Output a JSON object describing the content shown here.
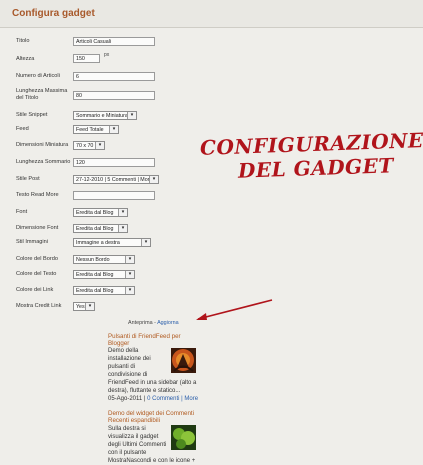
{
  "header": {
    "title": "Configura gadget"
  },
  "form": {
    "titolo": {
      "label": "Titolo",
      "value": "Articoli Casuali"
    },
    "altezza": {
      "label": "Altezza",
      "value": "150",
      "unit": "px"
    },
    "numero": {
      "label": "Numero di Articoli",
      "value": "6"
    },
    "lunghezza_titolo": {
      "label": "Lunghezza Massima del Titolo",
      "value": "80"
    },
    "stile_snippet": {
      "label": "Stile Snippet",
      "value": "Sommario e Miniatura"
    },
    "feed": {
      "label": "Feed",
      "value": "Feed Totale"
    },
    "dimensioni_miniatura": {
      "label": "Dimensioni Miniatura",
      "value": "70 x 70"
    },
    "lunghezza_sommario": {
      "label": "Lunghezza Sommario",
      "value": "120"
    },
    "stile_post": {
      "label": "Stile Post",
      "value": "27-12-2010 | 5 Commenti | More »"
    },
    "testo_read_more": {
      "label": "Testo Read More",
      "value": ""
    },
    "font": {
      "label": "Font",
      "value": "Eredita dal Blog"
    },
    "dimensione_font": {
      "label": "Dimensione Font",
      "value": "Eredita dal Blog"
    },
    "stil_immagini": {
      "label": "Stil Immagini",
      "value": "Immagine a destra"
    },
    "colore_bordo": {
      "label": "Colore del Bordo",
      "value": "Nessun Bordo"
    },
    "colore_testo": {
      "label": "Colore del Testo",
      "value": "Eredita dal Blog"
    },
    "colore_link": {
      "label": "Colore dei Link",
      "value": "Eredita dal Blog"
    },
    "mostra_credit": {
      "label": "Mostra Credit Link",
      "value": "Yes"
    }
  },
  "annotation": {
    "line1": "CONFIGURAZIONE",
    "line2": "DEL GADGET"
  },
  "preview": {
    "label": "Anteprima",
    "separator": " - ",
    "refresh": "Aggiorna",
    "posts": [
      {
        "title": "Pulsanti di FriendFeed per Blogger",
        "body": [
          "Demo della",
          "installazione dei",
          "pulsanti di",
          "condivisione di"
        ],
        "body_full": [
          "FriendFeed in una sidebar (alto a",
          "destra), fluttante e statico..."
        ],
        "meta_date": "05-Ago-2011 | ",
        "meta_comments": "0 Commenti",
        "meta_more": " | More"
      },
      {
        "title": "Demo del widget dei Commenti Recenti espandibili",
        "body": [
          "Sulla destra si",
          "visualizza il gadget",
          "degli Ultimi Commenti",
          "con il pulsante"
        ],
        "body_full": [
          "MostraNascondi e con le icone +"
        ]
      }
    ]
  },
  "colors": {
    "accent": "#a8592b",
    "annotation": "#b0141b",
    "link": "#2a5eaa"
  }
}
